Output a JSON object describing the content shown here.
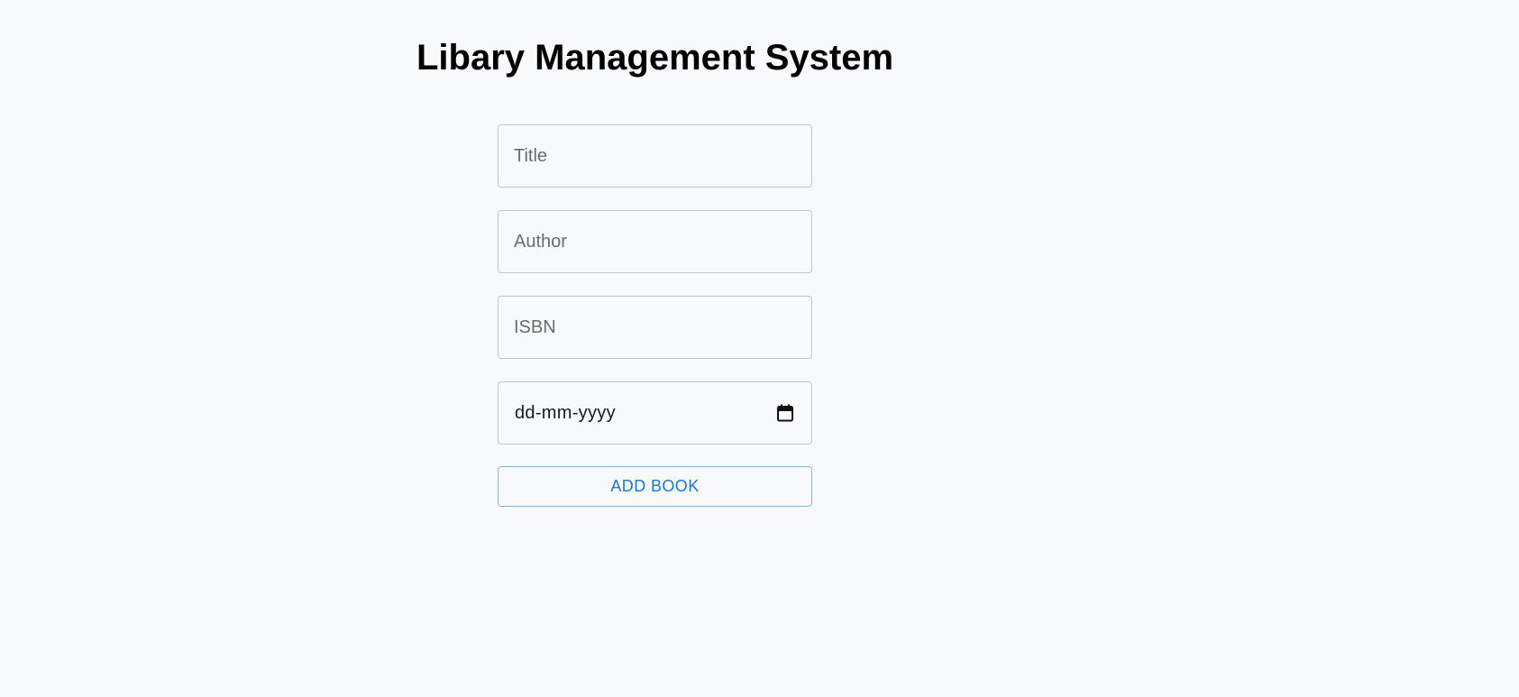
{
  "header": {
    "title": "Libary Management System"
  },
  "form": {
    "title_field": {
      "placeholder": "Title",
      "value": ""
    },
    "author_field": {
      "placeholder": "Author",
      "value": ""
    },
    "isbn_field": {
      "placeholder": "ISBN",
      "value": ""
    },
    "date_field": {
      "display": "dd-mm-yyyy",
      "icon": "calendar-icon"
    },
    "submit_label": "ADD BOOK"
  },
  "colors": {
    "background": "#f8f9fa",
    "accent": "#1976d2",
    "border": "#c4c4c4"
  }
}
